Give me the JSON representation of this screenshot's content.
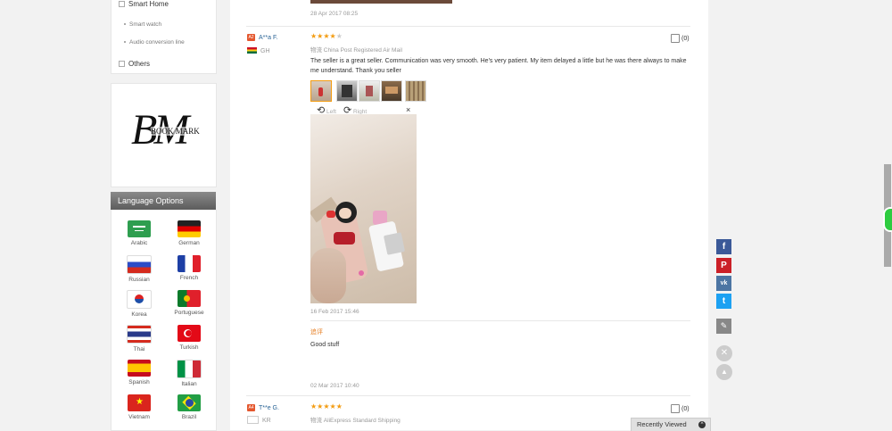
{
  "sidebar": {
    "category": "Smart Home",
    "subitems": [
      "Smart watch",
      "Audio conversion line"
    ],
    "others": "Others"
  },
  "bookmark": {
    "letters": "BM",
    "subtitle": "BOOK MARK"
  },
  "languages": {
    "heading": "Language Options",
    "items": [
      {
        "label": "Arabic"
      },
      {
        "label": "German"
      },
      {
        "label": "Russian"
      },
      {
        "label": "French"
      },
      {
        "label": "Korea"
      },
      {
        "label": "Portuguese"
      },
      {
        "label": "Thai"
      },
      {
        "label": "Turkish"
      },
      {
        "label": "Spanish"
      },
      {
        "label": "Italian"
      },
      {
        "label": "Vietnam"
      },
      {
        "label": "Brazil"
      }
    ]
  },
  "reviews": {
    "top_date": "28 Apr 2017 08:25",
    "r1": {
      "badge": "A2",
      "name": "A**a F.",
      "country_code": "GH",
      "rating": 4,
      "shipping": "物流 China Post Registered Air Mail",
      "text": "The seller is a great seller. Communication was very smooth. He's very patient. My item delayed a little but he was there always to make me understand. Thank you seller",
      "helpful": "(0)",
      "rotate_left": "Left",
      "rotate_right": "Right",
      "close": "×",
      "date": "16 Feb 2017 15:46",
      "followup_label": "追评",
      "followup_text": "Good stuff",
      "followup_date": "02 Mar 2017 10:40"
    },
    "r2": {
      "badge": "A4",
      "name": "T**e G.",
      "country_code": "KR",
      "rating": 5,
      "shipping": "物流 AliExpress Standard Shipping",
      "helpful": "(0)"
    }
  },
  "recently_viewed": "Recently Viewed",
  "colors": {
    "accent": "#f39c12",
    "link": "#2a6496",
    "badge": "#e4572e"
  }
}
